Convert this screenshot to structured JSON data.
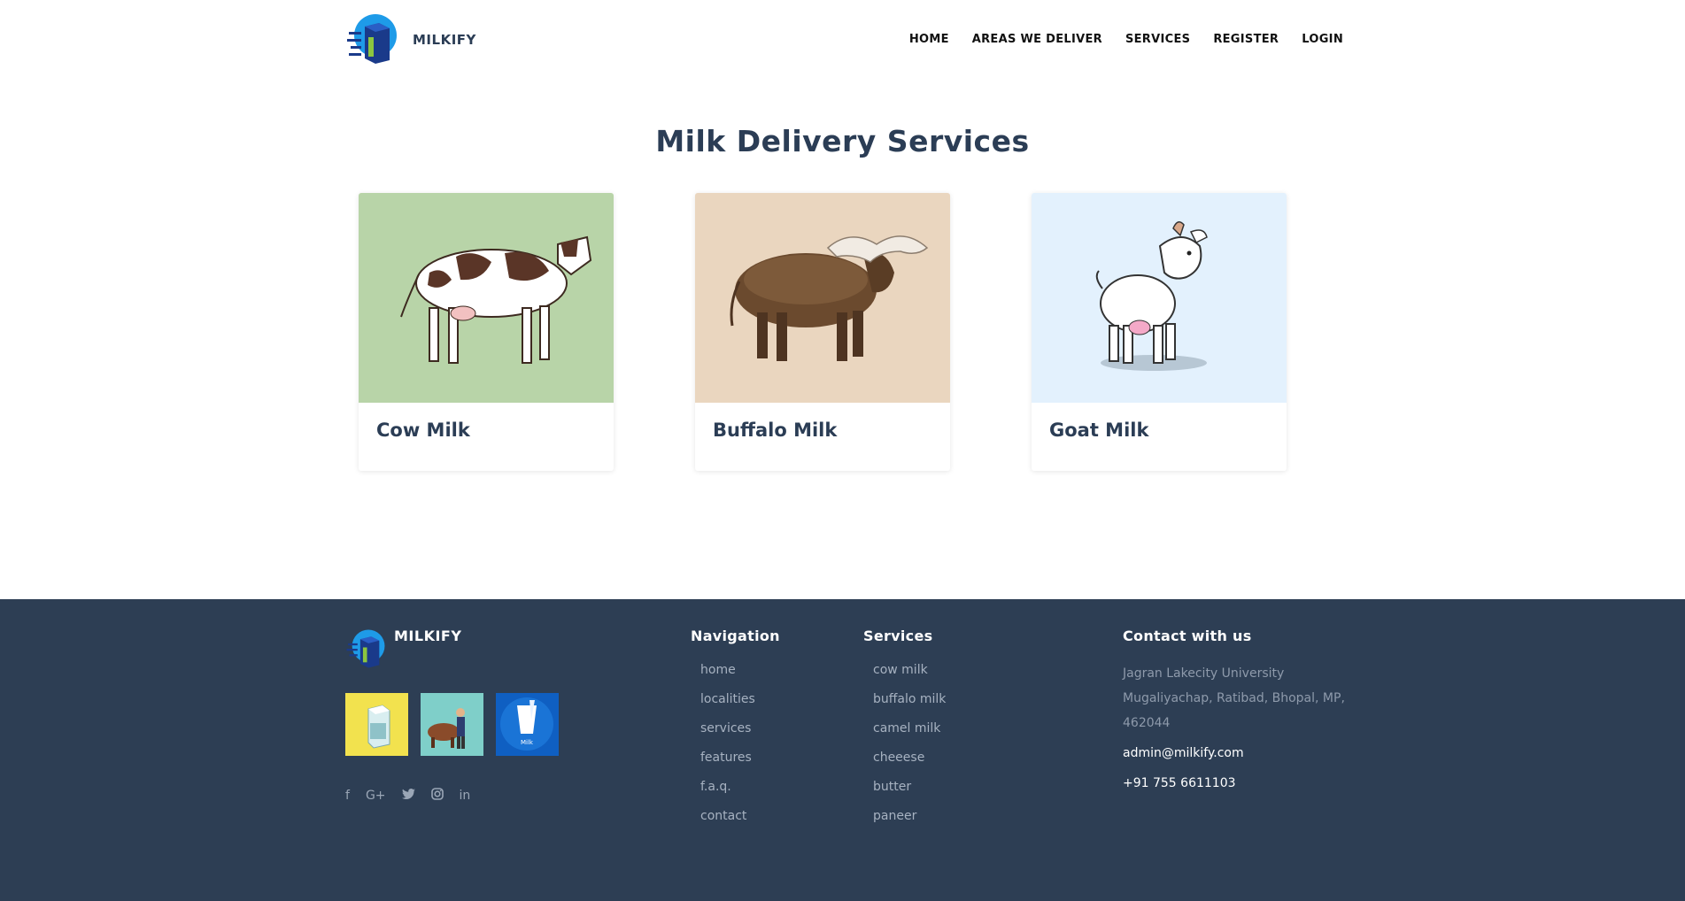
{
  "header": {
    "brand": "MILKIFY",
    "nav": [
      "HOME",
      "AREAS WE DELIVER",
      "SERVICES",
      "REGISTER",
      "LOGIN"
    ]
  },
  "main": {
    "title": "Milk Delivery Services",
    "cards": [
      {
        "title": "Cow Milk",
        "bg": "#b8d4a8",
        "icon": "cow-image"
      },
      {
        "title": "Buffalo Milk",
        "bg": "#ead6bf",
        "icon": "buffalo-image"
      },
      {
        "title": "Goat Milk",
        "bg": "#e3f1fd",
        "icon": "goat-image"
      }
    ]
  },
  "footer": {
    "brand": "MILKIFY",
    "thumbnails": [
      "milk-carton-image",
      "farmer-cow-image",
      "milk-glass-image"
    ],
    "thumbnail_label": "Milk",
    "social_icons": [
      "facebook-icon",
      "google-plus-icon",
      "twitter-icon",
      "instagram-icon",
      "linkedin-icon"
    ],
    "navigation": {
      "heading": "Navigation",
      "items": [
        "home",
        "localities",
        "services",
        "features",
        "f.a.q.",
        "contact"
      ]
    },
    "services": {
      "heading": "Services",
      "items": [
        "cow milk",
        "buffalo milk",
        "camel milk",
        "cheeese",
        "butter",
        "paneer"
      ]
    },
    "contact": {
      "heading": "Contact with us",
      "address": "Jagran Lakecity University Mugaliyachap, Ratibad, Bhopal, MP, 462044",
      "email": "admin@milkify.com",
      "phone": "+91 755 6611103"
    }
  },
  "colors": {
    "footer_bg": "#2d3e54",
    "heading": "#2b3d55",
    "logo_blue": "#1e9be8",
    "logo_green": "#8cc63f"
  }
}
